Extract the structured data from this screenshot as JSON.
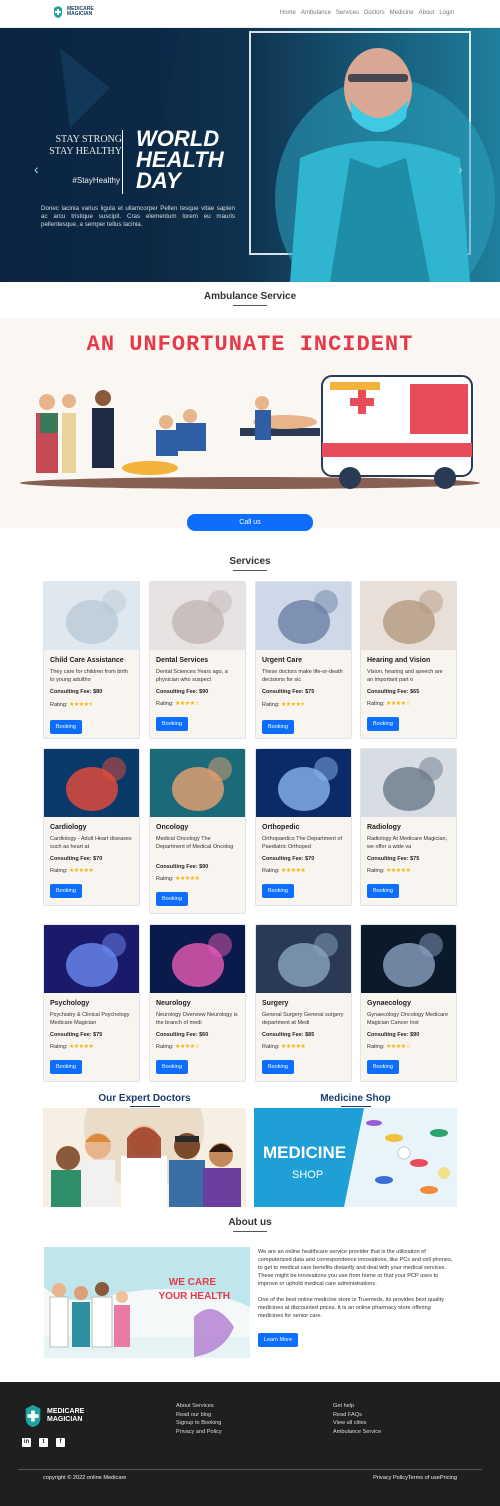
{
  "nav": {
    "brand_line1": "MEDICARE",
    "brand_line2": "MAGICIAN",
    "items": [
      "Home",
      "Ambulance",
      "Services",
      "Doctors",
      "Medicine",
      "About",
      "Login"
    ]
  },
  "hero": {
    "left_line1": "STAY STRONG",
    "left_line2": "STAY HEALTHY",
    "hashtag": "#StayHealthy",
    "title_line1": "WORLD",
    "title_line2": "HEALTH",
    "title_line3": "DAY",
    "description": "Donec lacinia varius ligula et ullamcorper Pellen tesque vitae sapien ac arcu tristique suscipit. Cras elementum lorem eu mauris pellentesque, a semper tellus lacinia.",
    "prev_icon": "chevron-left-icon",
    "next_icon": "chevron-right-icon"
  },
  "ambulance": {
    "section_title": "Ambulance Service",
    "banner_text": "AN UNFORTUNATE INCIDENT",
    "call_label": "Call us"
  },
  "services": {
    "section_title": "Services",
    "fee_label": "Consulting Fee:",
    "rating_label": "Rating:",
    "booking_label": "Booking",
    "cards": [
      {
        "title": "Child Care Assistance",
        "desc": "They care for children from birth to young adultho",
        "fee": "$80",
        "stars": "★★★★⯨"
      },
      {
        "title": "Dental Services",
        "desc": "Dental Sciences Years ago, a physician who suspect",
        "fee": "$90",
        "stars": "★★★★☆"
      },
      {
        "title": "Urgent Care",
        "desc": "These doctors make life-or-death decisions for sic",
        "fee": "$75",
        "stars": "★★★★⯨"
      },
      {
        "title": "Hearing and Vision",
        "desc": "Vision, hearing and speech are an important part o",
        "fee": "$65",
        "stars": "★★★★☆"
      },
      {
        "title": "Cardiology",
        "desc": "Cardiology - Adult Heart diseases such as heart at",
        "fee": "$70",
        "stars": "★★★★★"
      },
      {
        "title": "Oncology",
        "desc": "Medical Oncology The Department of Medical Oncolog",
        "fee": "$90",
        "stars": "★★★★★"
      },
      {
        "title": "Orthopedic",
        "desc": "Orthopaedics The Department of Paediatric Orthoped",
        "fee": "$70",
        "stars": "★★★★★"
      },
      {
        "title": "Radiology",
        "desc": "Radiology At Medicare Magician, we offer a wide va",
        "fee": "$75",
        "stars": "★★★★★"
      },
      {
        "title": "Psychology",
        "desc": "Psychiatry & Clinical Psychology Medicare Magician",
        "fee": "$75",
        "stars": "★★★★★"
      },
      {
        "title": "Neurology",
        "desc": "Neurology Overview Neurology is the branch of medi",
        "fee": "$60",
        "stars": "★★★★☆"
      },
      {
        "title": "Surgery",
        "desc": "General Surgery General surgery department at Medi",
        "fee": "$85",
        "stars": "★★★★★"
      },
      {
        "title": "Gynaecology",
        "desc": "Gynaecology Oncology Medicare Magician Cancer Inst",
        "fee": "$90",
        "stars": "★★★★☆"
      }
    ]
  },
  "doctors": {
    "title": "Our Expert Doctors"
  },
  "medicine": {
    "title": "Medicine Shop",
    "banner_line1": "MEDICINE",
    "banner_line2": "SHOP"
  },
  "about": {
    "title": "About us",
    "image_line1": "WE CARE",
    "image_line2": "YOUR HEALTH",
    "para1": "We are an online healthcare service provider that is the utilization of computerized data and correspondence innovations, like PCs and cell phones, to get to medical care benefits distantly and deal with your medical services. These might be innovations you use from home or that your PCP uses to improve or uphold medical care administrations.",
    "para2": "One of the best online medicine store is Truemeds, its provides best quality medicines at discounted prices. It is an online pharmacy store offering medicines for senior care.",
    "button": "Learn More"
  },
  "footer": {
    "brand_line1": "MEDICARE",
    "brand_line2": "MAGICIAN",
    "col1": [
      "About Services",
      "Read our blog",
      "Signup to Booking",
      "Privacy and Policy"
    ],
    "col2": [
      "Get help",
      "Read FAQs",
      "View all cities",
      "Ambulance Service"
    ],
    "social": [
      "linkedin-icon",
      "twitter-icon",
      "facebook-icon"
    ],
    "copyright": "copyright © 2022 online Medicare",
    "links": "Privacy PolicyTerms of usePricing"
  },
  "colors": {
    "primary": "#0d6efd",
    "accent_red": "#e8394a",
    "footer_bg": "#1f1f1f",
    "hero_bg": "#0c2138"
  }
}
